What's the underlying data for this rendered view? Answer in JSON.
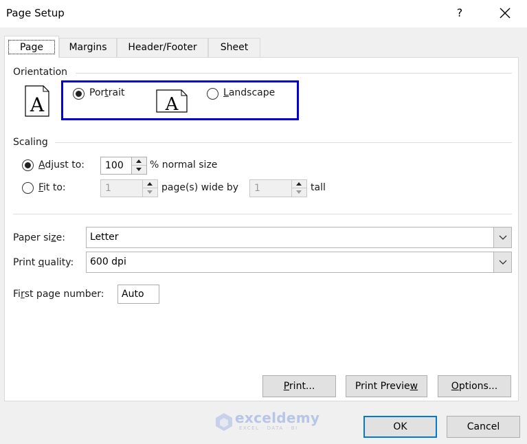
{
  "window": {
    "title": "Page Setup",
    "help_label": "?",
    "close_icon": "close-icon"
  },
  "tabs": [
    {
      "label": "Page",
      "active": true
    },
    {
      "label": "Margins",
      "active": false
    },
    {
      "label": "Header/Footer",
      "active": false
    },
    {
      "label": "Sheet",
      "active": false
    }
  ],
  "orientation": {
    "group_label": "Orientation",
    "selected": "Portrait",
    "portrait": {
      "pre": "Por",
      "mnemonic": "t",
      "post": "rait",
      "checked": true,
      "icon": "portrait-page-icon"
    },
    "landscape": {
      "pre": "",
      "mnemonic": "L",
      "post": "andscape",
      "checked": false,
      "icon": "landscape-page-icon"
    },
    "icon_glyph": "A",
    "highlight_color": "#0000d4"
  },
  "scaling": {
    "group_label": "Scaling",
    "adjust_to": {
      "mnemonic": "A",
      "post": "djust to:",
      "checked": true,
      "value": "100",
      "suffix": "% normal size"
    },
    "fit_to": {
      "mnemonic": "F",
      "post": "it to:",
      "checked": false,
      "wide_value": "1",
      "wide_suffix": "page(s) wide by",
      "tall_value": "1",
      "tall_suffix": "tall"
    }
  },
  "paper_size": {
    "pre": "Paper si",
    "mnemonic": "z",
    "post": "e:",
    "value": "Letter"
  },
  "print_quality": {
    "pre": "Print ",
    "mnemonic": "q",
    "post": "uality:",
    "value": "600 dpi"
  },
  "first_page_number": {
    "pre": "Fi",
    "mnemonic": "r",
    "post": "st page number:",
    "value": "Auto"
  },
  "panel_buttons": {
    "print": {
      "pre": "",
      "mnemonic": "P",
      "post": "rint..."
    },
    "print_preview": {
      "pre": "Print Previe",
      "mnemonic": "w",
      "post": ""
    },
    "options": {
      "pre": "",
      "mnemonic": "O",
      "post": "ptions..."
    }
  },
  "dialog_buttons": {
    "ok": "OK",
    "cancel": "Cancel"
  },
  "watermark": {
    "brand": "exceldemy",
    "tagline": "EXCEL · DATA · BI"
  },
  "colors": {
    "accent": "#0078d7",
    "highlight": "#0000d4"
  }
}
